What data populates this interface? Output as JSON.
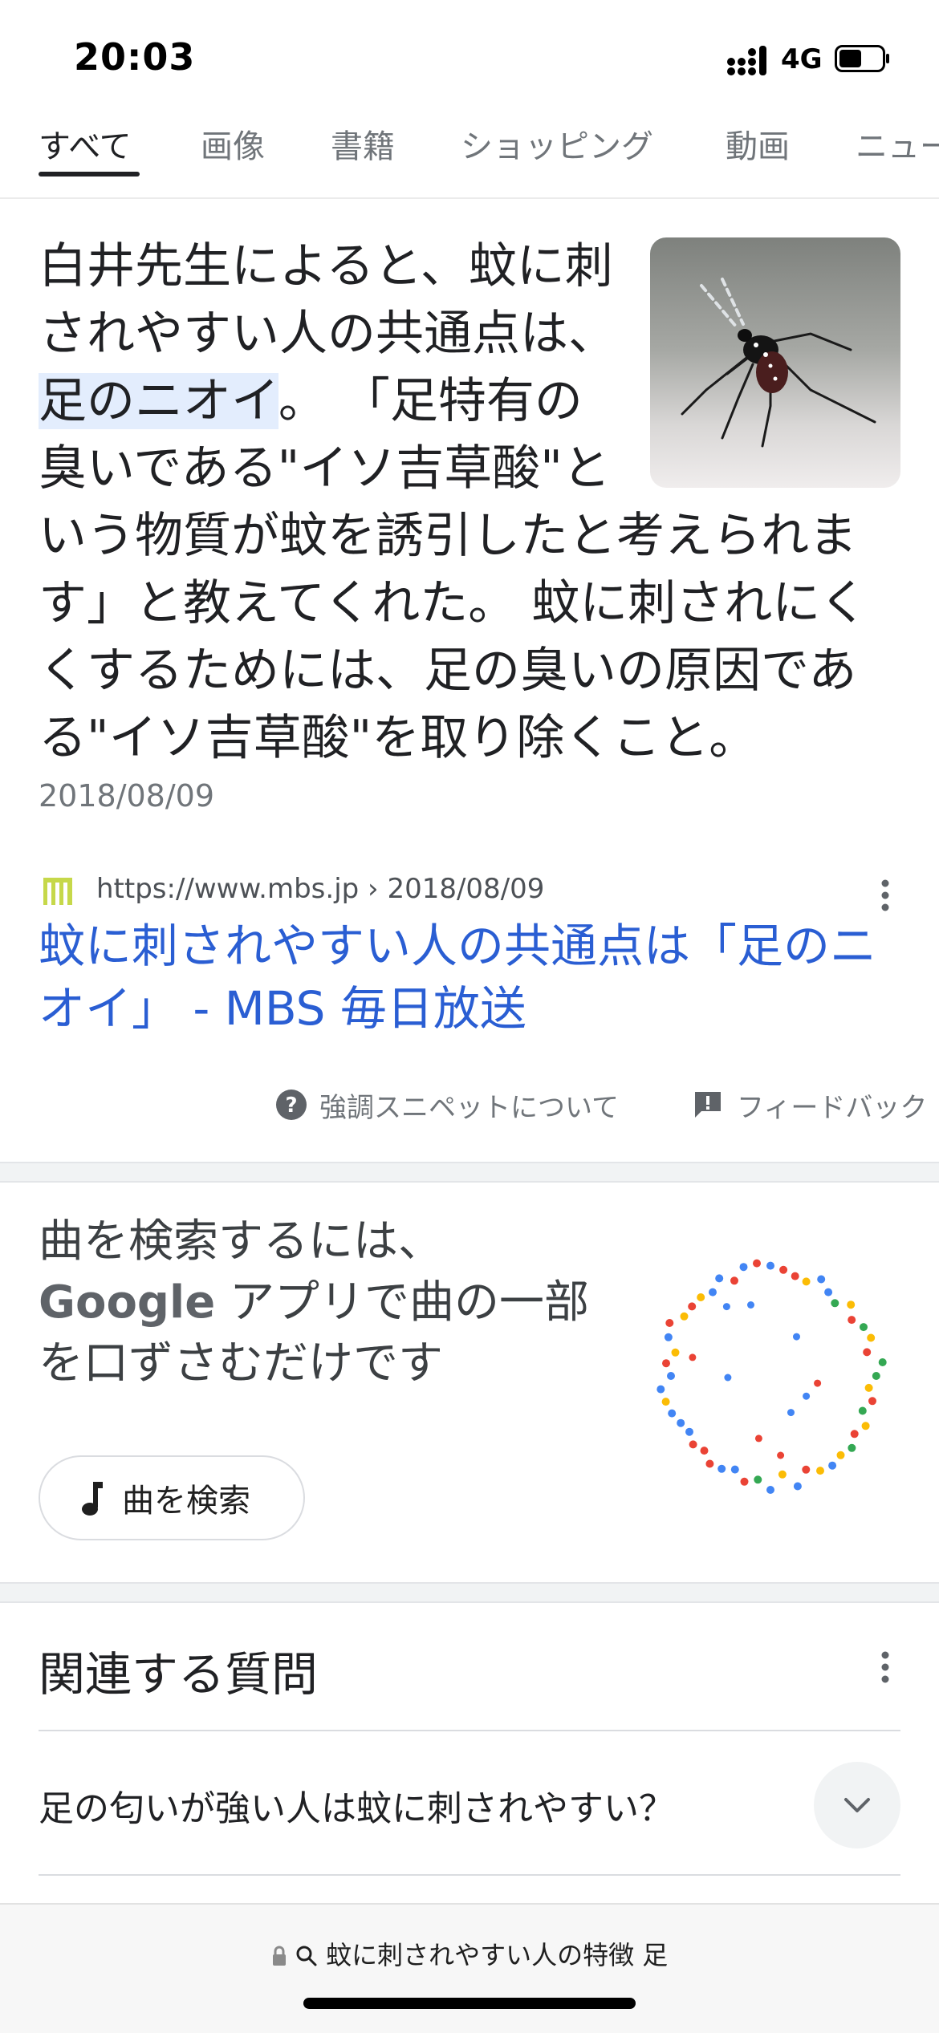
{
  "status_bar": {
    "time": "20:03",
    "network": "4G"
  },
  "tabs": [
    "すべて",
    "画像",
    "書籍",
    "ショッピング",
    "動画",
    "ニュー"
  ],
  "snippet": {
    "text_before": "白井先生によると、蚊に刺されやすい人の共通点は、",
    "highlight": "足のニオイ",
    "text_after": "。 「足特有の臭いである\"イソ吉草酸\"という物質が蚊を誘引したと考えられます」と教えてくれた。 蚊に刺されにくくするためには、足の臭いの原因である\"イソ吉草酸\"を取り除くこと。",
    "date": "2018/08/09"
  },
  "source": {
    "url": "https://www.mbs.jp › 2018/08/09",
    "title": "蚊に刺されやすい人の共通点は「足のニオイ」 - MBS 毎日放送"
  },
  "snippet_footer": {
    "about": "強調スニペットについて",
    "feedback": "フィードバック"
  },
  "song_search": {
    "text_1": "曲を検索するには、",
    "brand": "Google",
    "text_2": " アプリで曲の一部を口ずさむだけです",
    "button": "曲を検索"
  },
  "related": {
    "title": "関連する質問",
    "questions": [
      "足の匂いが強い人は蚊に刺されやすい？"
    ]
  },
  "url_bar": {
    "query": "蚊に刺されやすい人の特徴 足"
  },
  "colors": {
    "link": "#2a5ed3",
    "highlight": "#e3edfd",
    "text": "#202124",
    "muted": "#70757a"
  }
}
